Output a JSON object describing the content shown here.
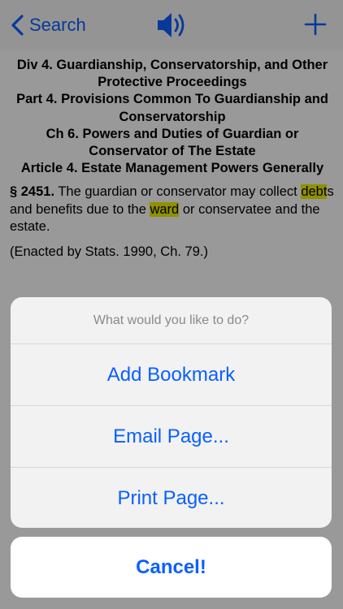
{
  "navbar": {
    "back_label": "Search",
    "left_icon": "chevron-left-icon",
    "center_icon": "speaker-icon",
    "right_icon": "plus-icon",
    "accent_color": "#0a60ff"
  },
  "content": {
    "headings": [
      "Div 4. Guardianship, Conservatorship, and Other Protective Proceedings",
      "Part 4. Provisions Common To Guardianship and Conservatorship",
      "Ch 6. Powers and Duties of Guardian or Conservator of The Estate",
      "Article 4. Estate Management Powers Generally"
    ],
    "section_number": "§ 2451.",
    "text_1": " The guardian or conservator may collect ",
    "highlight_1": "debt",
    "text_2": "s and benefits due to the ",
    "highlight_2": "ward",
    "text_3": " or conservatee and the estate.",
    "enacted": "(Enacted by Stats. 1990, Ch. 79.)",
    "highlight_color": "#f0f000"
  },
  "action_sheet": {
    "title": "What would you like to do?",
    "options": [
      "Add Bookmark",
      "Email Page...",
      "Print Page..."
    ],
    "cancel_label": "Cancel!"
  }
}
